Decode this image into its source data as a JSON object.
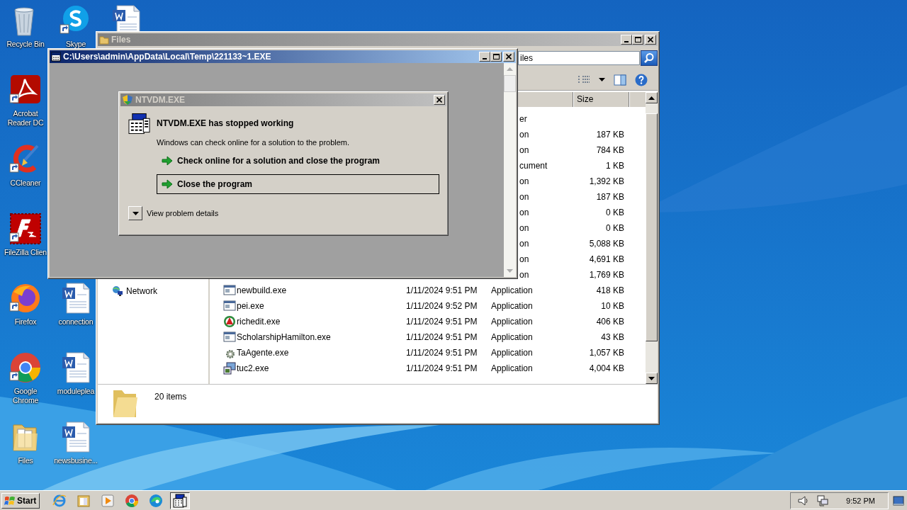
{
  "desktop": {
    "icons": [
      {
        "kind": "recycle",
        "label": "Recycle Bin",
        "shortcut": false
      },
      {
        "kind": "skype",
        "label": "Skype",
        "shortcut": true
      },
      {
        "kind": "word",
        "shortcut": false
      },
      {
        "kind": "acrobat",
        "label": "Acrobat\nReader DC",
        "shortcut": true
      },
      {
        "kind": "ccleaner",
        "label": "CCleaner",
        "shortcut": true
      },
      {
        "kind": "filezilla",
        "label": "FileZilla Clien",
        "shortcut": true
      },
      {
        "kind": "firefox",
        "label": "Firefox",
        "shortcut": true
      },
      {
        "kind": "word",
        "label": "connection",
        "shortcut": false
      },
      {
        "kind": "chrome",
        "label": "Google\nChrome",
        "shortcut": true
      },
      {
        "kind": "word",
        "label": "moduleplea",
        "shortcut": false
      },
      {
        "kind": "folder",
        "label": "Files",
        "shortcut": false
      },
      {
        "kind": "word",
        "label": "newsbusine...",
        "shortcut": false
      }
    ]
  },
  "explorer": {
    "title": "Files",
    "search": {
      "value": "iles"
    },
    "columns": [
      {
        "label": "Size"
      }
    ],
    "nav": [
      {
        "label": "Network"
      }
    ],
    "rows": [
      {
        "kind": "partial",
        "type": "er"
      },
      {
        "kind": "partial",
        "type": "on",
        "size": "187 KB"
      },
      {
        "kind": "partial",
        "type": "on",
        "size": "784 KB"
      },
      {
        "kind": "partial",
        "type": "cument",
        "size": "1 KB"
      },
      {
        "kind": "partial",
        "type": "on",
        "size": "1,392 KB"
      },
      {
        "kind": "partial",
        "type": "on",
        "size": "187 KB"
      },
      {
        "kind": "partial",
        "type": "on",
        "size": "0 KB"
      },
      {
        "kind": "partial",
        "type": "on",
        "size": "0 KB"
      },
      {
        "kind": "partial",
        "type": "on",
        "size": "5,088 KB"
      },
      {
        "kind": "partial",
        "type": "on",
        "size": "4,691 KB"
      },
      {
        "kind": "partial",
        "type": "on",
        "size": "1,769 KB"
      },
      {
        "kind": "window",
        "name": "newbuild.exe",
        "date": "1/11/2024 9:51 PM",
        "type": "Application",
        "size": "418 KB"
      },
      {
        "kind": "window",
        "name": "pei.exe",
        "date": "1/11/2024 9:52 PM",
        "type": "Application",
        "size": "10 KB"
      },
      {
        "kind": "badge",
        "name": "richedit.exe",
        "date": "1/11/2024 9:51 PM",
        "type": "Application",
        "size": "406 KB"
      },
      {
        "kind": "window",
        "name": "ScholarshipHamilton.exe",
        "date": "1/11/2024 9:51 PM",
        "type": "Application",
        "size": "43 KB"
      },
      {
        "kind": "gear",
        "name": "TaAgente.exe",
        "date": "1/11/2024 9:51 PM",
        "type": "Application",
        "size": "1,057 KB"
      },
      {
        "kind": "setup",
        "name": "tuc2.exe",
        "date": "1/11/2024 9:51 PM",
        "type": "Application",
        "size": "4,004 KB"
      }
    ],
    "status": "20 items"
  },
  "console": {
    "title": "C:\\Users\\admin\\AppData\\Local\\Temp\\221133~1.EXE"
  },
  "dialog": {
    "title": "NTVDM.EXE",
    "heading": "NTVDM.EXE has stopped working",
    "message": "Windows can check online for a solution to the problem.",
    "options": [
      {
        "label": "Check online for a solution and close the program",
        "selected": false
      },
      {
        "label": "Close the program",
        "selected": true
      }
    ],
    "details_toggle": "View problem details"
  },
  "taskbar": {
    "start": "Start",
    "apps": [
      {
        "kind": "ie",
        "selected": false
      },
      {
        "kind": "explorer",
        "selected": false
      },
      {
        "kind": "media",
        "selected": false
      },
      {
        "kind": "chrome",
        "selected": false
      },
      {
        "kind": "edge",
        "selected": false
      },
      {
        "kind": "console",
        "selected": true
      }
    ],
    "clock": "9:52 PM"
  }
}
